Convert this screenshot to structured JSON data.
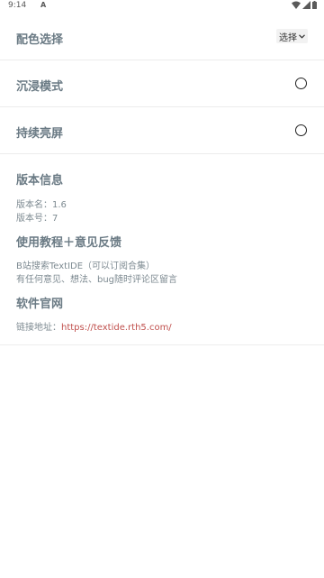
{
  "status_bar": {
    "time": "9:14",
    "notification": "A"
  },
  "settings": {
    "color_scheme": {
      "label": "配色选择",
      "select_value": "选择"
    },
    "immersive_mode": {
      "label": "沉浸模式"
    },
    "keep_screen_on": {
      "label": "持续亮屏"
    }
  },
  "version_info": {
    "title": "版本信息",
    "version_name": "版本名：1.6",
    "version_code": "版本号：7"
  },
  "tutorial": {
    "title": "使用教程＋意见反馈",
    "line1": "B站搜索TextIDE（可以订阅合集）",
    "line2": "有任何意见、想法、bug随时评论区留言"
  },
  "website": {
    "title": "软件官网",
    "link_prefix": "链接地址：",
    "link_url": "https://textide.rth5.com/"
  },
  "icons": {
    "wifi": "wifi-icon",
    "signal": "signal-icon",
    "battery": "battery-icon",
    "chevron": "chevron-down-icon"
  }
}
